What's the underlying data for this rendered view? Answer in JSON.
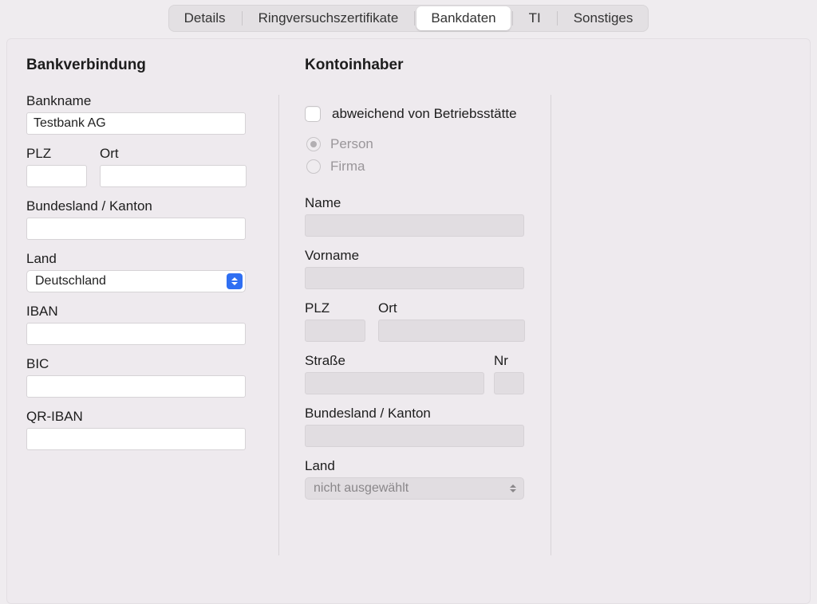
{
  "tabs": {
    "details": "Details",
    "ring": "Ringversuchszertifikate",
    "bank": "Bankdaten",
    "ti": "TI",
    "other": "Sonstiges"
  },
  "bank": {
    "section_title": "Bankverbindung",
    "bankname_label": "Bankname",
    "bankname_value": "Testbank AG",
    "plz_label": "PLZ",
    "plz_value": "",
    "ort_label": "Ort",
    "ort_value": "",
    "state_label": "Bundesland / Kanton",
    "state_value": "",
    "country_label": "Land",
    "country_value": "Deutschland",
    "iban_label": "IBAN",
    "iban_value": "",
    "bic_label": "BIC",
    "bic_value": "",
    "qriban_label": "QR-IBAN",
    "qriban_value": ""
  },
  "holder": {
    "section_title": "Kontoinhaber",
    "diff_label": "abweichend von Betriebsstätte",
    "diff_checked": false,
    "type_person": "Person",
    "type_firma": "Firma",
    "name_label": "Name",
    "name_value": "",
    "vorname_label": "Vorname",
    "vorname_value": "",
    "plz_label": "PLZ",
    "plz_value": "",
    "ort_label": "Ort",
    "ort_value": "",
    "strasse_label": "Straße",
    "strasse_value": "",
    "nr_label": "Nr",
    "nr_value": "",
    "state_label": "Bundesland / Kanton",
    "state_value": "",
    "country_label": "Land",
    "country_value": "nicht ausgewählt"
  }
}
